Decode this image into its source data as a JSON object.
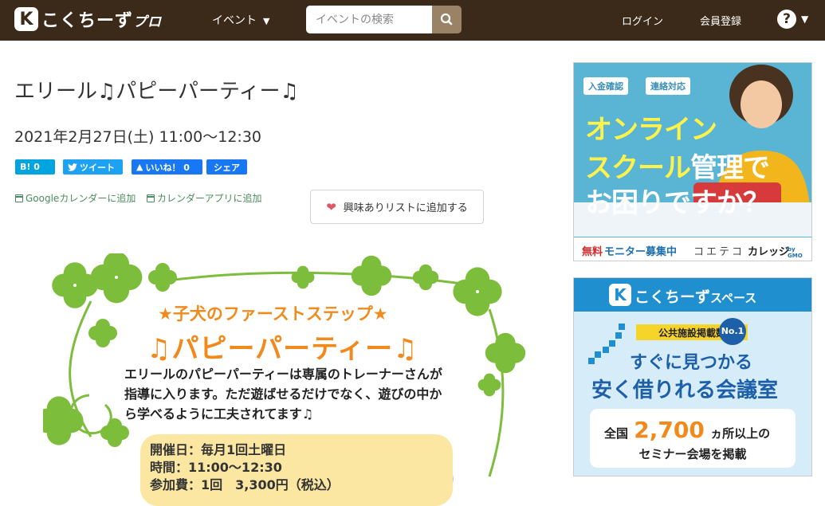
{
  "header": {
    "logo_mark": "K",
    "logo_text": "こくちーず",
    "logo_suffix": "プロ",
    "nav_event": "イベント",
    "search_placeholder": "イベントの検索",
    "login": "ログイン",
    "register": "会員登録",
    "help": "?"
  },
  "event": {
    "title": "エリール♫パピーパーティー♫",
    "datetime": "2021年2月27日(土) 11:00～12:30",
    "share": {
      "hatena": "B! 0",
      "tweet": "ツイート",
      "like": "いいね！ 0",
      "share": "シェア"
    },
    "calendar": {
      "google": "Googleカレンダーに追加",
      "app": "カレンダーアプリに追加"
    },
    "interest_button": "興味ありリストに追加する"
  },
  "flyer": {
    "subtitle": "★子犬のファーストステップ★",
    "title": "♫パピーパーティー♫",
    "body": [
      "エリールのパピーパーティーは専属のトレーナーさんが",
      "指導に入ります。ただ遊ばせるだけでなく、遊びの中か",
      "ら学べるように工夫されてます♫"
    ],
    "info": [
      "開催日：毎月1回土曜日",
      "時間：11:00～12:30",
      "参加費：1回　3,300円（税込）"
    ]
  },
  "ads": {
    "ad1": {
      "tag1": "入金確認",
      "tag2": "連絡対応",
      "line1": "オンライン",
      "line2a": "スクール",
      "line2b": "管理",
      "line2c": "で",
      "line3": "お困りですか？",
      "footer_red": "無料",
      "footer_blue": "モニター募集中",
      "footer_brand": "コエテコ",
      "footer_brand2": "カレッジ",
      "footer_gmo": "by GMO"
    },
    "ad2": {
      "logo": "こくちーず",
      "logo_suffix": "スペース",
      "badge": "公共施設掲載数",
      "no1": "No.1",
      "line1": "すぐに見つかる",
      "line2": "安く借りれる会議室",
      "box_pre": "全国",
      "box_num": "2,700",
      "box_post": "ヵ所以上の",
      "box_line2": "セミナー会場を掲載"
    }
  },
  "colors": {
    "header_bg": "#3b2a1a",
    "hatena": "#00a4de",
    "twitter": "#1da1f2",
    "facebook": "#1877f2",
    "calendar_link": "#4a8c5c",
    "flyer_orange": "#f08a1c",
    "clover_green": "#7cbd3c"
  }
}
